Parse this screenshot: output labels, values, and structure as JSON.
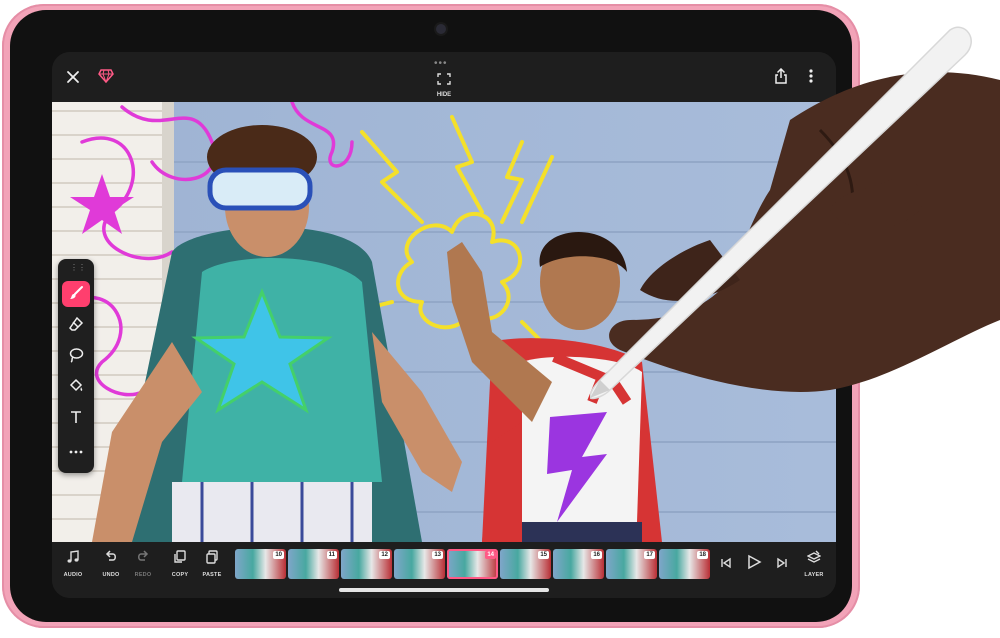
{
  "topbar": {
    "close_icon": "close-icon",
    "premium_icon": "gem-icon",
    "hide_label": "HIDE",
    "share_icon": "share-icon",
    "more_icon": "more-vertical-icon"
  },
  "tools": [
    {
      "name": "brush",
      "icon": "brush-icon",
      "active": true
    },
    {
      "name": "eraser",
      "icon": "eraser-icon",
      "active": false
    },
    {
      "name": "lasso",
      "icon": "lasso-icon",
      "active": false
    },
    {
      "name": "fill",
      "icon": "fill-bucket-icon",
      "active": false
    },
    {
      "name": "text",
      "icon": "text-icon",
      "active": false
    },
    {
      "name": "more",
      "icon": "more-icon",
      "active": false
    }
  ],
  "bottombar": {
    "audio_label": "AUDIO",
    "undo_label": "UNDO",
    "redo_label": "REDO",
    "copy_label": "COPY",
    "paste_label": "PASTE",
    "layer_label": "LAYER",
    "frames": [
      "10",
      "11",
      "12",
      "13",
      "14",
      "15",
      "16",
      "17",
      "18"
    ],
    "selected_frame": "14"
  },
  "colors": {
    "accent": "#ff3f6e",
    "device_pink": "#f2a3b8",
    "toolbar_bg": "#1e1e1e"
  }
}
